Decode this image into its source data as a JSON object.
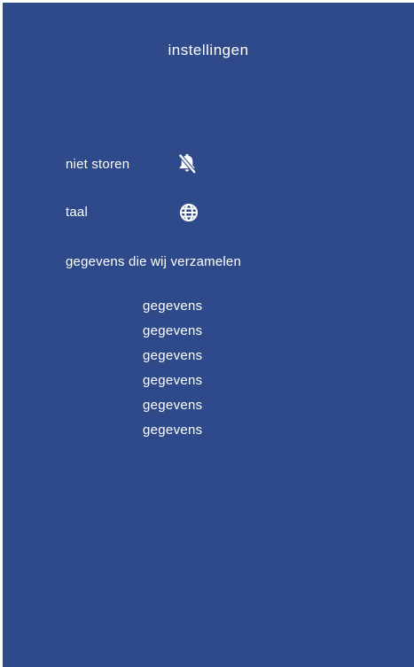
{
  "header": {
    "title": "instellingen"
  },
  "settings": {
    "do_not_disturb": {
      "label": "niet storen",
      "icon": "bell-off-icon"
    },
    "language": {
      "label": "taal",
      "icon": "globe-icon"
    },
    "collected_data": {
      "label": "gegevens die wij verzamelen",
      "items": [
        "gegevens",
        "gegevens",
        "gegevens",
        "gegevens",
        "gegevens",
        "gegevens"
      ]
    }
  },
  "colors": {
    "background": "#2f4a8b",
    "text": "#ffffff"
  }
}
